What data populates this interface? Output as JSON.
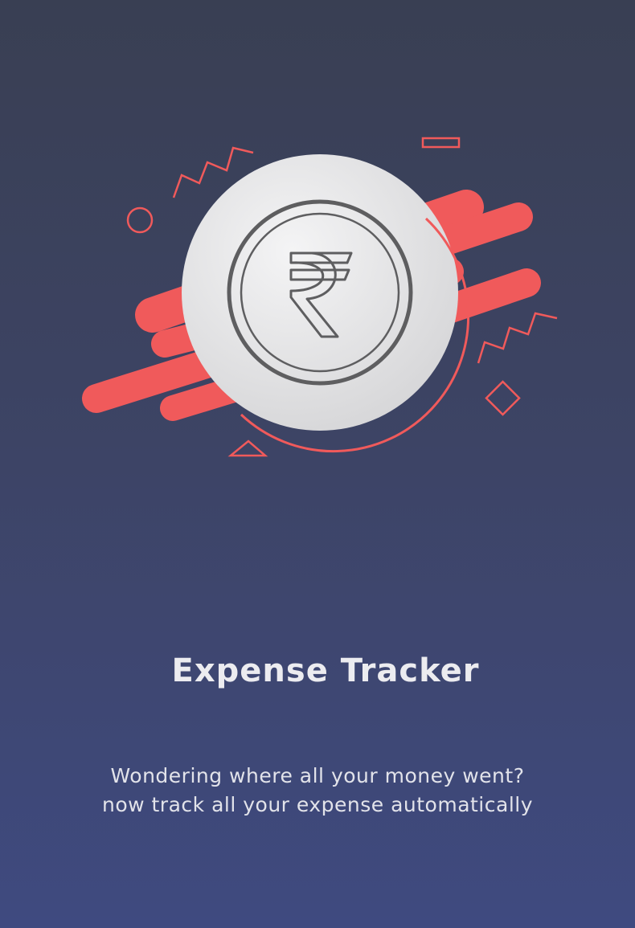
{
  "onboarding": {
    "title": "Expense Tracker",
    "description_line1": "Wondering where all your money went?",
    "description_line2": "now track all your expense automatically"
  },
  "illustration": {
    "icon": "rupee-coin-icon",
    "accent_color": "#f05a5b",
    "coin_color": "#e6e6e8",
    "glyph_color": "#5a5a5a"
  }
}
